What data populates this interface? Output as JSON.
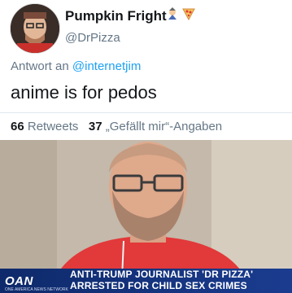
{
  "author": {
    "display_name": "Pumpkin Fright",
    "handle": "@DrPizza",
    "name_emoji": [
      "person-in-costume-emoji",
      "pizza-emoji"
    ]
  },
  "reply": {
    "prefix": "Antwort an",
    "target": "@internetjim"
  },
  "tweet": {
    "text": "anime is for pedos"
  },
  "stats": {
    "retweets_count": "66",
    "retweets_label": "Retweets",
    "likes_count": "37",
    "likes_label": "„Gefällt mir“-Angaben"
  },
  "media": {
    "network_logo": "OAN",
    "network_tagline": "ONE AMERICA NEWS NETWORK",
    "headline_line1": "ANTI-TRUMP JOURNALIST 'DR PIZZA'",
    "headline_line2": "ARRESTED FOR CHILD SEX CRIMES"
  },
  "colors": {
    "text": "#14171a",
    "secondary": "#657786",
    "link": "#1da1f2",
    "banner": "#1b3c8f"
  }
}
